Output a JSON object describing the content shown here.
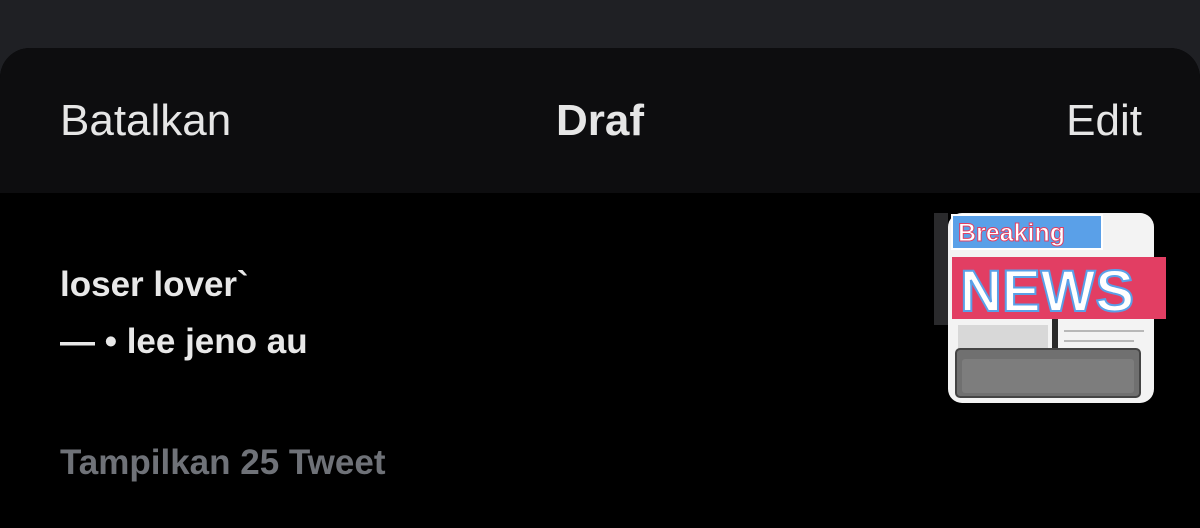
{
  "header": {
    "cancel_label": "Batalkan",
    "title": "Draf",
    "edit_label": "Edit"
  },
  "draft": {
    "line1": "loser lover`",
    "line2": "— • lee jeno au",
    "thumbnail": {
      "badge_top": "Breaking",
      "badge_bottom": "NEWS"
    }
  },
  "show_more_label": "Tampilkan 25 Tweet",
  "colors": {
    "background": "#000000",
    "outer": "#1f2024",
    "text": "#e6e6e6",
    "muted": "#6f7278",
    "badge_blue": "#5aa0e8",
    "badge_pink": "#e23e63"
  }
}
